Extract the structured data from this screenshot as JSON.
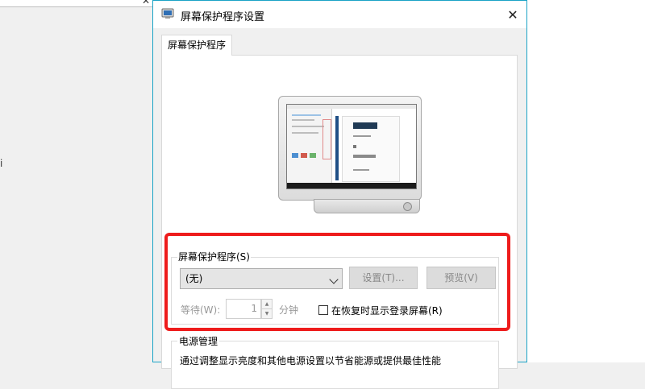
{
  "window": {
    "title": "屏幕保护程序设置",
    "close_glyph": "✕"
  },
  "tab": {
    "label": "屏幕保护程序"
  },
  "screensaver": {
    "group_label": "屏幕保护程序(S)",
    "selected": "(无)",
    "settings_button": "设置(T)...",
    "preview_button": "预览(V)",
    "wait_label": "等待(W):",
    "wait_value": "1",
    "minutes_label": "分钟",
    "resume_checkbox_label": "在恢复时显示登录屏幕(R)",
    "resume_checked": false
  },
  "power": {
    "group_label": "电源管理",
    "description": "通过调整显示亮度和其他电源设置以节省能源或提供最佳性能"
  },
  "colors": {
    "highlight": "#ee1c1c",
    "window_border": "#1aa3c6"
  }
}
